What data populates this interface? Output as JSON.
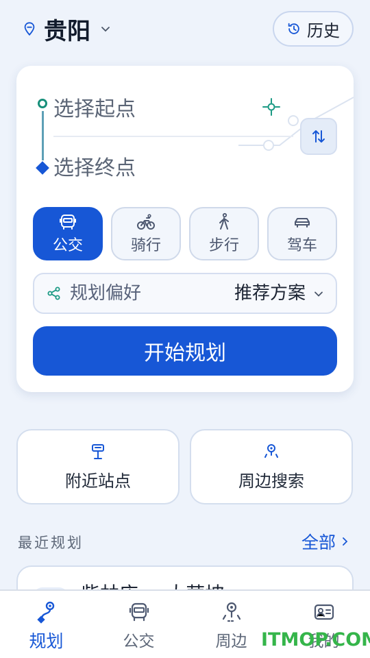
{
  "header": {
    "city": "贵阳",
    "history_label": "历史"
  },
  "route": {
    "start_placeholder": "选择起点",
    "end_placeholder": "选择终点"
  },
  "modes": [
    {
      "label": "公交",
      "icon": "bus-icon",
      "active": true
    },
    {
      "label": "骑行",
      "icon": "bike-icon",
      "active": false
    },
    {
      "label": "步行",
      "icon": "walk-icon",
      "active": false
    },
    {
      "label": "驾车",
      "icon": "car-icon",
      "active": false
    }
  ],
  "preference": {
    "label": "规划偏好",
    "value": "推荐方案"
  },
  "plan_button": "开始规划",
  "quick_actions": [
    {
      "label": "附近站点",
      "icon": "bus-stop-icon"
    },
    {
      "label": "周边搜索",
      "icon": "location-search-icon"
    }
  ],
  "recent": {
    "title": "最近规划",
    "all_label": "全部",
    "item_text": "柴林店 → 大营坡"
  },
  "tabs": [
    {
      "label": "规划",
      "icon": "route-icon",
      "active": true
    },
    {
      "label": "公交",
      "icon": "bus-icon",
      "active": false
    },
    {
      "label": "周边",
      "icon": "nearby-icon",
      "active": false
    },
    {
      "label": "我的",
      "icon": "profile-card-icon",
      "active": false
    }
  ],
  "watermark": "ITMOP.COM",
  "colors": {
    "accent": "#1757d6",
    "start_dot": "#178f7a",
    "background": "#eef3fb",
    "watermark": "#35b54a"
  }
}
